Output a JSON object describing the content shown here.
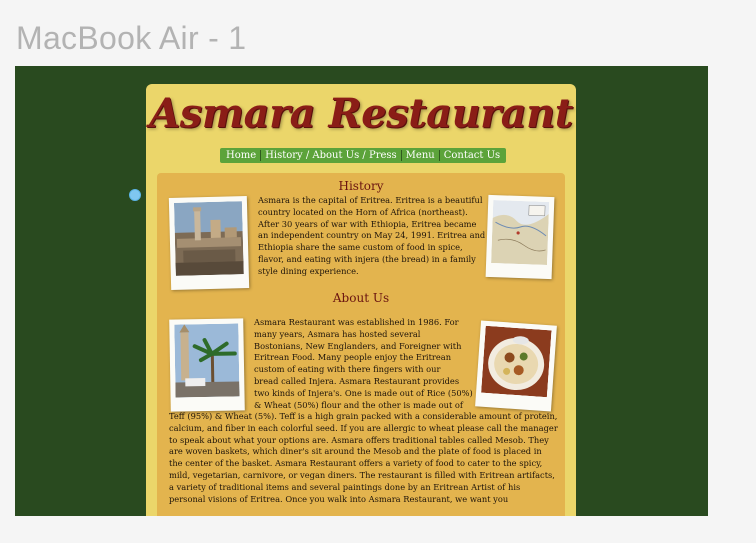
{
  "frame": {
    "label": "MacBook Air - 1"
  },
  "site": {
    "logo": "Asmara Restaurant",
    "nav": [
      {
        "label": "Home"
      },
      {
        "label": "History / About Us / Press"
      },
      {
        "label": "Menu"
      },
      {
        "label": "Contact Us"
      }
    ],
    "history": {
      "heading": "History",
      "lines": [
        "Asmara is the capital of Eritrea. Eritrea is a beautiful",
        "country located on the Horn of Africa (northeast).",
        "After 30 years of war with Ethiopia, Eritrea became",
        "an independent country on May 24, 1991. Eritrea and",
        "Ethiopia share the same custom of food in spice,",
        "flavor, and eating with injera (the bread) in a family",
        "style dining experience."
      ]
    },
    "about": {
      "heading": "About Us",
      "lines_narrow": [
        "Asmara Restaurant was established in 1986. For",
        "many years, Asmara has hosted several",
        "Bostonians, New Englanders, and Foreigner with",
        "Eritrean Food. Many people enjoy the Eritrean",
        "custom of eating with there fingers with our",
        "bread called Injera. Asmara Restaurant provides",
        "two kinds of Injera's. One is made out of Rice (50%)",
        "& Wheat (50%) flour and the other is made out of"
      ],
      "lines_wide": [
        "Teff (95%) & Wheat (5%). Teff is a high grain packed with a considerable amount of protein,",
        "calcium, and fiber in each colorful seed. If you are allergic to wheat please call the manager",
        "to speak about what your options are.  Asmara offers traditional tables called Mesob. They",
        "are woven baskets, which diner's sit around the Mesob and the plate of food is placed in",
        "the center of the basket. Asmara Restaurant offers a variety of food to cater to the spicy,",
        "mild, vegetarian, carnivore, or vegan diners. The restaurant is filled with Eritrean artifacts,",
        "a variety of traditional items and several paintings done by an Eritrean Artist of his",
        "personal visions of Eritrea. Once you walk into Asmara Restaurant, we want you"
      ]
    }
  },
  "colors": {
    "canvas": "#294a1f",
    "page": "#ebd66a",
    "content": "#e3b44e",
    "nav": "#5ca33a",
    "logo": "#8a1d17"
  }
}
